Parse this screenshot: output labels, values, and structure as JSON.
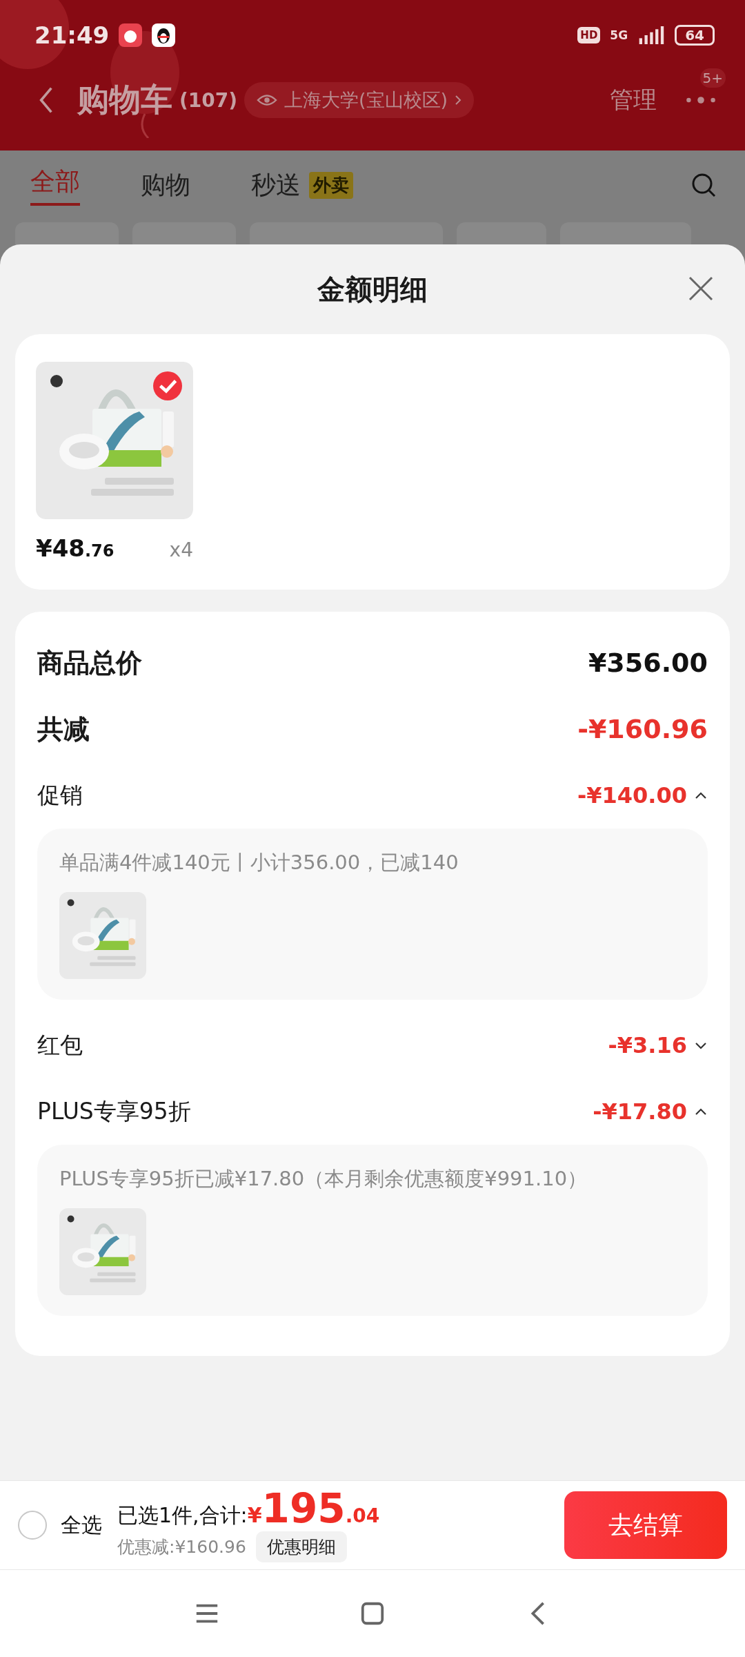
{
  "status_bar": {
    "time": "21:49",
    "hd": "HD",
    "network": "5G",
    "battery": "64"
  },
  "header": {
    "title": "购物车",
    "count": "(107)",
    "location": "上海大学(宝山校区)",
    "manage": "管理",
    "more_badge": "5+"
  },
  "tabs": [
    {
      "label": "全部",
      "selected": true
    },
    {
      "label": "购物",
      "selected": false
    },
    {
      "label": "秒送",
      "tag": "外卖",
      "selected": false
    }
  ],
  "sheet": {
    "title": "金额明细",
    "product": {
      "checked": true,
      "price_main": "¥48",
      "price_decimal": ".76",
      "quantity": "x4"
    },
    "rows": [
      {
        "kind": "total",
        "label": "商品总价",
        "value": "¥356.00"
      },
      {
        "kind": "reduction",
        "label": "共减",
        "value": "-¥160.96"
      },
      {
        "kind": "discount",
        "label": "促销",
        "value": "-¥140.00",
        "expanded": true,
        "detail": "单品满4件减140元丨小计356.00，已减140"
      },
      {
        "kind": "discount",
        "label": "红包",
        "value": "-¥3.16",
        "expanded": false
      },
      {
        "kind": "discount",
        "label": "PLUS专享95折",
        "value": "-¥17.80",
        "expanded": true,
        "detail": "PLUS专享95折已减¥17.80（本月剩余优惠额度¥991.10）"
      }
    ]
  },
  "bottom_bar": {
    "select_all": {
      "label": "全选",
      "checked": false
    },
    "summary_label": "已选1件,合计:",
    "currency": "¥",
    "total_main": "195",
    "total_decimal": ".04",
    "discount": "优惠减:¥160.96",
    "detail_button": "优惠明细",
    "checkout": "去结算"
  }
}
